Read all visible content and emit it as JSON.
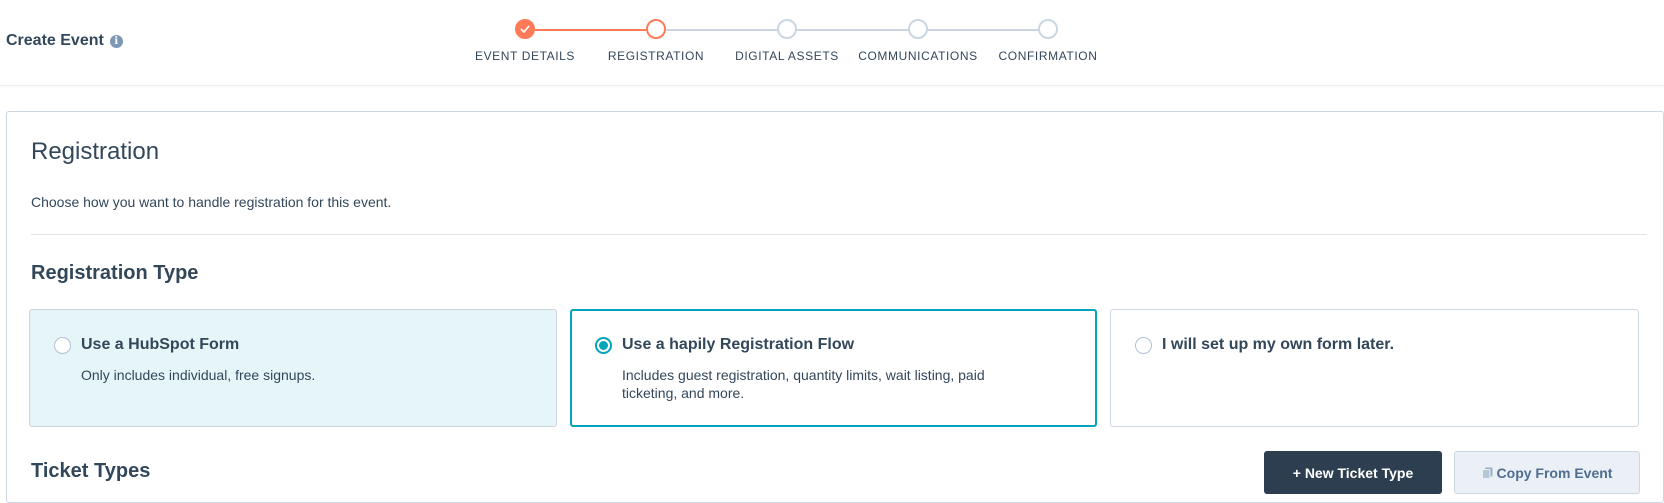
{
  "header": {
    "title": "Create Event",
    "steps": [
      {
        "label": "EVENT DETAILS",
        "state": "done"
      },
      {
        "label": "REGISTRATION",
        "state": "active"
      },
      {
        "label": "DIGITAL ASSETS",
        "state": "todo"
      },
      {
        "label": "COMMUNICATIONS",
        "state": "todo"
      },
      {
        "label": "CONFIRMATION",
        "state": "todo"
      }
    ]
  },
  "main": {
    "title": "Registration",
    "description": "Choose how you want to handle registration for this event.",
    "registration_type": {
      "heading": "Registration Type",
      "options": [
        {
          "title": "Use a HubSpot Form",
          "description": "Only includes individual, free signups.",
          "selected": false
        },
        {
          "title": "Use a hapily Registration Flow",
          "description": "Includes guest registration, quantity limits, wait listing, paid ticketing, and more.",
          "selected": true
        },
        {
          "title": "I will set up my own form later.",
          "description": "",
          "selected": false
        }
      ]
    },
    "ticket_types": {
      "heading": "Ticket Types",
      "new_button": "+ New Ticket Type",
      "copy_button": "Copy From Event"
    }
  },
  "colors": {
    "accent": "#ff7a59",
    "selected": "#00a4bd",
    "primary_button": "#2d3e50",
    "text": "#33475b"
  }
}
